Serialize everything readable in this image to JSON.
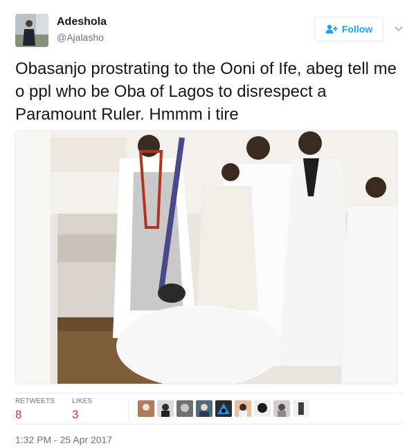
{
  "author": {
    "display_name": "Adeshola",
    "handle": "@Ajalasho"
  },
  "follow_button": {
    "label": "Follow"
  },
  "tweet": {
    "text": "Obasanjo prostrating to the Ooni of Ife, abeg tell me o ppl who be Oba of Lagos to disrespect a Paramount Ruler. Hmmm i tire"
  },
  "stats": {
    "retweets_label": "RETWEETS",
    "retweets_count": "8",
    "likes_label": "LIKES",
    "likes_count": "3"
  },
  "timestamp": "1:32 PM - 25 Apr 2017",
  "colors": {
    "accent": "#1da1f2",
    "likes_red": "#e0245e",
    "muted": "#657786",
    "border": "#e6ecf0"
  },
  "icons": [
    "follow-person-plus-icon",
    "chevron-down-icon"
  ]
}
